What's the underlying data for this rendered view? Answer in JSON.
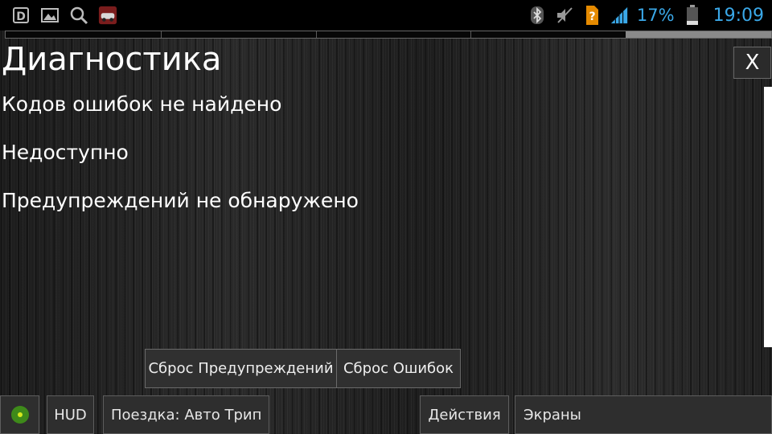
{
  "status_bar": {
    "icons_left": [
      "d-notification-icon",
      "image-icon",
      "search-icon",
      "game-thumbnail-icon"
    ],
    "icons_right": [
      "bluetooth-icon",
      "mute-icon",
      "alert-sim-icon",
      "signal-icon",
      "battery-icon"
    ],
    "battery_percent": "17%",
    "time": "19:09",
    "accent_color": "#3aa8e8"
  },
  "progress": {
    "fraction": 0.81,
    "segments": 4
  },
  "diagnostics": {
    "title": "Диагностика",
    "close_label": "X",
    "lines": [
      "Кодов ошибок не найдено",
      "Недоступно",
      "Предупреждений не обнаружено"
    ]
  },
  "actions": {
    "reset_warnings": "Сброс Предупреждений",
    "reset_errors": "Сброс Ошибок"
  },
  "bottom_bar": {
    "status_indicator_color": "#3e8a1a",
    "hud": "HUD",
    "trip": "Поездка: Авто Трип",
    "actions": "Действия",
    "screens": "Экраны"
  }
}
